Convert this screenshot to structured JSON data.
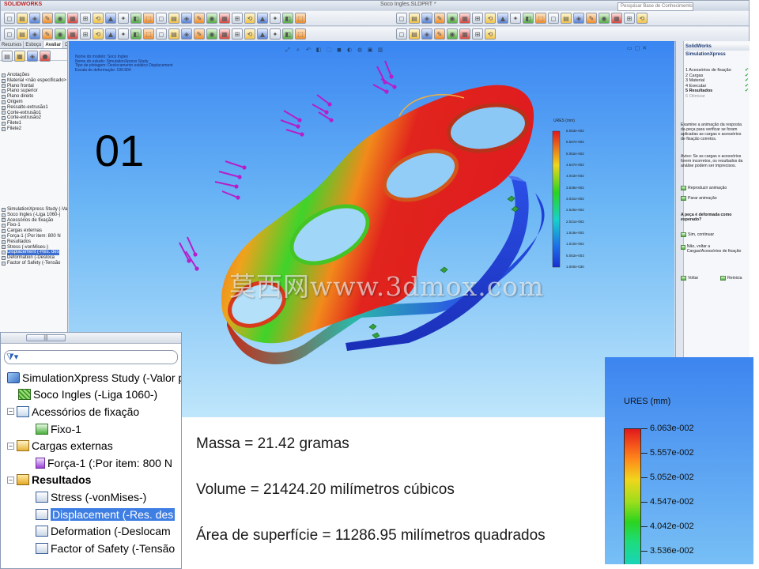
{
  "window": {
    "brand": "SOLIDWORKS",
    "document_title": "Soco Ingles.SLDPRT *",
    "search_placeholder": "Pesquisar Base de Conhecimento"
  },
  "left_panel": {
    "tabs": [
      "Recursos",
      "Esboço",
      "Avaliar",
      "DimXpert",
      "Produtos Office"
    ],
    "active_tab": "Avaliar",
    "feature_tree": [
      "Anotações",
      "Material <não especificado>",
      "Plano frontal",
      "Plano superior",
      "Plano direito",
      "Origem",
      "Ressalto-extrusão1",
      "Corte-extrusão1",
      "Corte-extrusão2",
      "Filete1",
      "Filete2"
    ],
    "sim_tree": [
      "SimulationXpress Study (-Valor p",
      "Soco Ingles (-Liga 1060-)",
      "Acessórios de fixação",
      "Fixo-1",
      "Cargas externas",
      "Força-1 (:Por item: 800 N",
      "Resultados",
      "Stress (-vonMises-)",
      "Displacement (-Res. des",
      "Deformation (-Desloca",
      "Factor of Safety (-Tensão"
    ]
  },
  "viewport": {
    "info_lines": [
      "Nome do modelo: Soco Ingles",
      "Nome do estudo: SimulationXpress Study",
      "Tipo de plotagem: Deslocamento estático Displacement",
      "Escala de deformação: 190.904"
    ],
    "step_number": "01",
    "watermark": "莫西网www.3dmox.com",
    "legend": {
      "title": "URES (mm)",
      "labels": [
        "6.063e-002",
        "5.557e-002",
        "5.052e-002",
        "4.547e-002",
        "4.042e-002",
        "3.536e-002",
        "3.031e-002",
        "2.526e-002",
        "2.021e-002",
        "1.516e-002",
        "1.010e-002",
        "5.052e-003",
        "1.000e-030"
      ]
    }
  },
  "task_pane": {
    "title": "SolidWorks SimulationXpress",
    "steps": [
      {
        "label": "1  Acessórios de fixação",
        "done": true
      },
      {
        "label": "2  Cargas",
        "done": true
      },
      {
        "label": "3  Material",
        "done": true
      },
      {
        "label": "4  Executar",
        "done": true
      },
      {
        "label": "5  Resultados",
        "done": true,
        "active": true
      },
      {
        "label": "6  Otimizar",
        "done": false
      }
    ],
    "check_mark": "✔",
    "instruction": "Examine a animação da resposta da peça para verificar se foram aplicadas as cargas e acessórios de fixação corretos.",
    "warning": "Aviso: Se as cargas e acessórios forem incorretos, os resultados da análise podem ser imprecisos.",
    "play_label": "Reproduzir animação",
    "stop_label": "Parar animação",
    "question": "A peça é deformada como esperado?",
    "yes_label": "Sim, continuar",
    "no_label": "Não, voltar a Cargas/Acessórios de fixação",
    "back_label": "Voltar",
    "restart_label": "Reinicia"
  },
  "zoom_tree": {
    "items": [
      {
        "label": "SimulationXpress Study (-Valor p",
        "icon": "study-icon",
        "level": 0,
        "expander": ""
      },
      {
        "label": "Soco Ingles (-Liga 1060-)",
        "icon": "material-icon",
        "level": 1,
        "expander": ""
      },
      {
        "label": "Acessórios de fixação",
        "icon": "fixture-icon",
        "level": 1,
        "expander": "−"
      },
      {
        "label": "Fixo-1",
        "icon": "fixed-constraint-icon",
        "level": 2,
        "expander": ""
      },
      {
        "label": "Cargas externas",
        "icon": "external-loads-icon",
        "level": 1,
        "expander": "−"
      },
      {
        "label": "Força-1 (:Por item: 800 N",
        "icon": "force-arrow-icon",
        "level": 2,
        "expander": ""
      },
      {
        "label": "Resultados",
        "icon": "results-folder-icon",
        "level": 1,
        "expander": "−",
        "bold": true
      },
      {
        "label": "Stress (-vonMises-)",
        "icon": "stress-plot-icon",
        "level": 2,
        "expander": ""
      },
      {
        "label": "Displacement (-Res. des",
        "icon": "displacement-plot-icon",
        "level": 2,
        "expander": "",
        "selected": true
      },
      {
        "label": "Deformation (-Deslocam",
        "icon": "deformation-plot-icon",
        "level": 2,
        "expander": ""
      },
      {
        "label": "Factor of Safety (-Tensão",
        "icon": "safety-plot-icon",
        "level": 2,
        "expander": ""
      }
    ]
  },
  "stats": {
    "mass": "Massa = 21.42 gramas",
    "volume": "Volume = 21424.20  milímetros cúbicos",
    "area": "Área de superfície = 11286.95  milímetros quadrados"
  },
  "zoom_legend": {
    "title": "URES (mm)",
    "labels": [
      "6.063e-002",
      "5.557e-002",
      "5.052e-002",
      "4.547e-002",
      "4.042e-002",
      "3.536e-002"
    ]
  },
  "colors": {
    "viewport_top": "#3a86f2",
    "viewport_bottom": "#bfe6fb",
    "max_displacement": "#e0191d",
    "min_displacement": "#1f3fd8",
    "load_arrow": "#b51fc9",
    "selection": "#3f7fe3"
  }
}
